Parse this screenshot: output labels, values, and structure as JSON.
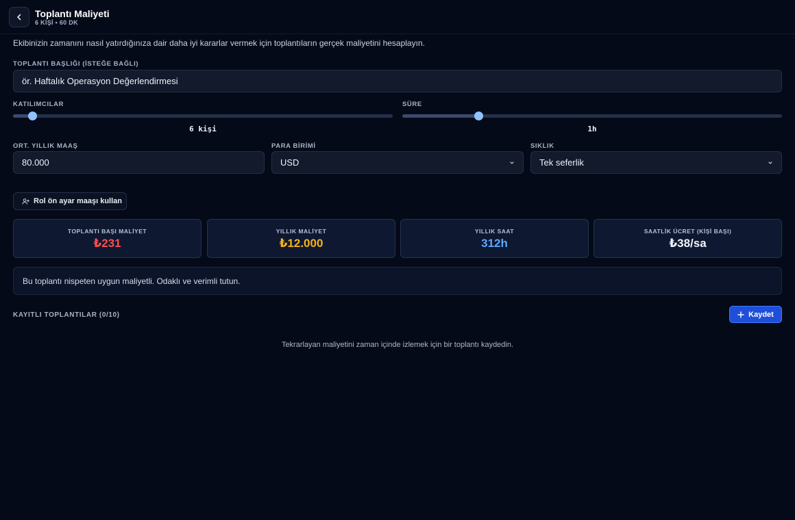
{
  "header": {
    "title": "Toplantı Maliyeti",
    "subtitle": "6 KİŞİ • 60 DK"
  },
  "description": "Ekibinizin zamanını nasıl yatırdığınıza dair daha iyi kararlar vermek için toplantıların gerçek maliyetini hesaplayın.",
  "meeting_title": {
    "label": "TOPLANTI BAŞLIĞI (İSTEĞE BAĞLI)",
    "value": "ör. Haftalık Operasyon Değerlendirmesi"
  },
  "participants": {
    "label": "KATILIMCILAR",
    "value_text": "6 kişi",
    "level": 0.05
  },
  "duration": {
    "label": "SÜRE",
    "value_text": "1h",
    "level": 0.2
  },
  "salary": {
    "label": "ORT. YILLIK MAAŞ",
    "value": "80.000"
  },
  "currency": {
    "label": "PARA BİRİMİ",
    "selected": "USD"
  },
  "frequency": {
    "label": "SIKLIK",
    "selected": "Tek seferlik"
  },
  "preset_button": {
    "label": "Rol ön ayar maaşı kullan"
  },
  "stats": [
    {
      "label": "TOPLANTI BAŞI MALİYET",
      "value": "₺231",
      "color": "#ff4d4f"
    },
    {
      "label": "YILLIK MALİYET",
      "value": "₺12.000",
      "color": "#f5b21b"
    },
    {
      "label": "YILLIK SAAT",
      "value": "312h",
      "color": "#5aa7ff"
    },
    {
      "label": "SAATLİK ÜCRET (KİŞİ BAŞI)",
      "value": "₺38/sa",
      "color": "#f2f4fa"
    }
  ],
  "notice": "Bu toplantı nispeten uygun maliyetli. Odaklı ve verimli tutun.",
  "saved": {
    "title": "KAYITLI TOPLANTILAR (0/10)",
    "save_label": "Kaydet",
    "empty_text": "Tekrarlayan maliyetini zaman içinde izlemek için bir toplantı kaydedin."
  },
  "colors": {
    "background": "#050a18",
    "accent": "#1f4fd8",
    "slider_thumb": "#8fc2ff"
  }
}
